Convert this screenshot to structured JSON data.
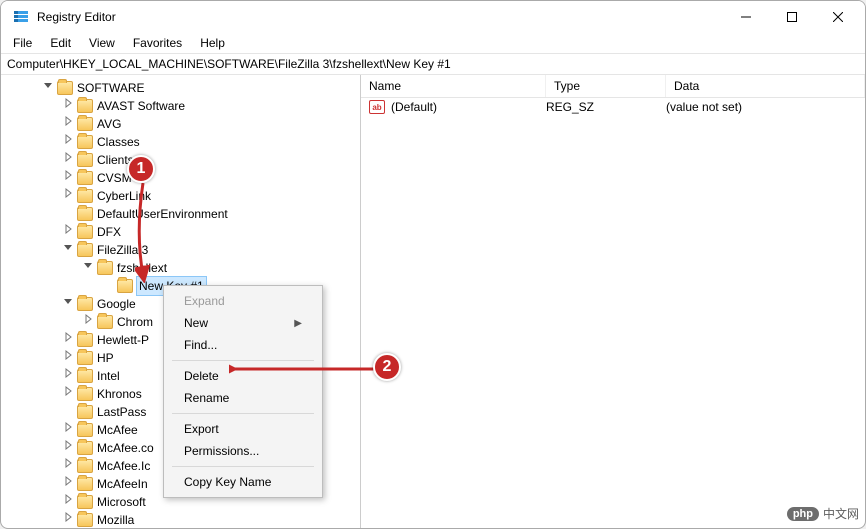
{
  "window": {
    "title": "Registry Editor"
  },
  "menubar": [
    "File",
    "Edit",
    "View",
    "Favorites",
    "Help"
  ],
  "addressbar": "Computer\\HKEY_LOCAL_MACHINE\\SOFTWARE\\FileZilla 3\\fzshellext\\New Key #1",
  "tree": [
    {
      "indent": 2,
      "twisty": "open",
      "label": "SOFTWARE"
    },
    {
      "indent": 3,
      "twisty": "closed",
      "label": "AVAST Software"
    },
    {
      "indent": 3,
      "twisty": "closed",
      "label": "AVG"
    },
    {
      "indent": 3,
      "twisty": "closed",
      "label": "Classes"
    },
    {
      "indent": 3,
      "twisty": "closed",
      "label": "Clients"
    },
    {
      "indent": 3,
      "twisty": "closed",
      "label": "CVSM"
    },
    {
      "indent": 3,
      "twisty": "closed",
      "label": "CyberLink"
    },
    {
      "indent": 3,
      "twisty": "none",
      "label": "DefaultUserEnvironment"
    },
    {
      "indent": 3,
      "twisty": "closed",
      "label": "DFX"
    },
    {
      "indent": 3,
      "twisty": "open",
      "label": "FileZilla 3"
    },
    {
      "indent": 4,
      "twisty": "open",
      "label": "fzshellext"
    },
    {
      "indent": 5,
      "twisty": "none",
      "label": "New Key #1",
      "selected": true
    },
    {
      "indent": 3,
      "twisty": "open",
      "label": "Google"
    },
    {
      "indent": 4,
      "twisty": "closed",
      "label": "Chrom"
    },
    {
      "indent": 3,
      "twisty": "closed",
      "label": "Hewlett-P"
    },
    {
      "indent": 3,
      "twisty": "closed",
      "label": "HP"
    },
    {
      "indent": 3,
      "twisty": "closed",
      "label": "Intel"
    },
    {
      "indent": 3,
      "twisty": "closed",
      "label": "Khronos"
    },
    {
      "indent": 3,
      "twisty": "none",
      "label": "LastPass"
    },
    {
      "indent": 3,
      "twisty": "closed",
      "label": "McAfee"
    },
    {
      "indent": 3,
      "twisty": "closed",
      "label": "McAfee.co"
    },
    {
      "indent": 3,
      "twisty": "closed",
      "label": "McAfee.Ic"
    },
    {
      "indent": 3,
      "twisty": "closed",
      "label": "McAfeeIn"
    },
    {
      "indent": 3,
      "twisty": "closed",
      "label": "Microsoft"
    },
    {
      "indent": 3,
      "twisty": "closed",
      "label": "Mozilla"
    }
  ],
  "list": {
    "headers": {
      "name": "Name",
      "type": "Type",
      "data": "Data"
    },
    "rows": [
      {
        "name": "(Default)",
        "type": "REG_SZ",
        "data": "(value not set)"
      }
    ]
  },
  "context_menu": [
    {
      "label": "Expand",
      "disabled": true
    },
    {
      "label": "New",
      "submenu": true
    },
    {
      "label": "Find..."
    },
    {
      "sep": true
    },
    {
      "label": "Delete"
    },
    {
      "label": "Rename"
    },
    {
      "sep": true
    },
    {
      "label": "Export"
    },
    {
      "label": "Permissions..."
    },
    {
      "sep": true
    },
    {
      "label": "Copy Key Name"
    }
  ],
  "annotations": {
    "badge1": "1",
    "badge2": "2"
  },
  "watermark": {
    "php": "php",
    "cn": "中文网"
  }
}
